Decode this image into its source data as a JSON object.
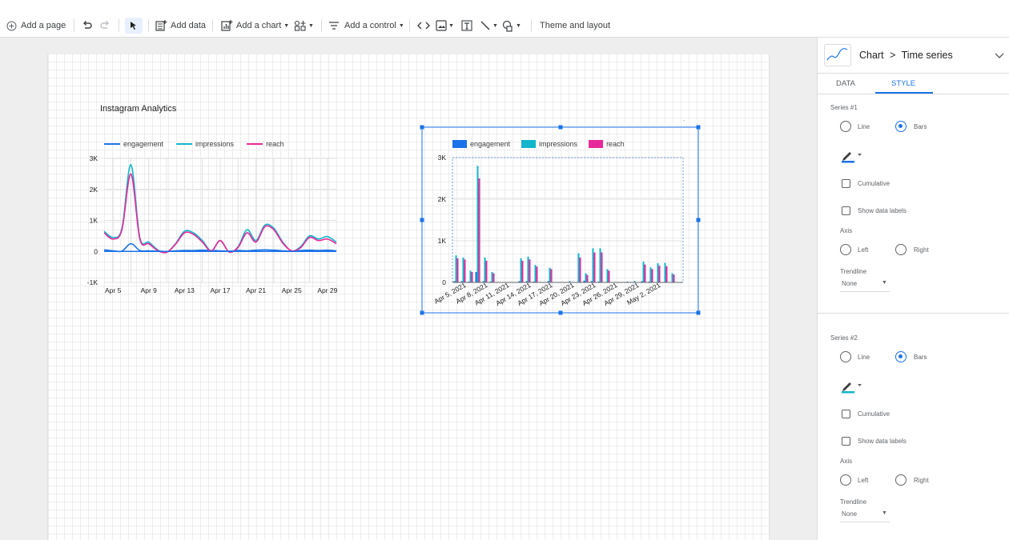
{
  "toolbar": {
    "add_page": "Add a page",
    "add_data": "Add data",
    "add_chart": "Add a chart",
    "add_control": "Add a control",
    "theme_layout": "Theme and layout"
  },
  "panel": {
    "chart_type": "Chart",
    "chart_sub": "Time series",
    "tabs": [
      "DATA",
      "STYLE"
    ],
    "active_tab": "STYLE",
    "series_sections": [
      {
        "title": "Series #1",
        "line": "Line",
        "bars": "Bars",
        "selected": "Bars",
        "cumulative": "Cumulative",
        "data_labels": "Show data labels",
        "axis": "Axis",
        "left": "Left",
        "right": "Right",
        "selected_axis": "none",
        "trendline": "Trendline",
        "trendline_value": "None",
        "color": "#1a73e8"
      },
      {
        "title": "Series #2",
        "line": "Line",
        "bars": "Bars",
        "selected": "Bars",
        "cumulative": "Cumulative",
        "data_labels": "Show data labels",
        "axis": "Axis",
        "left": "Left",
        "right": "Right",
        "selected_axis": "none",
        "trendline": "Trendline",
        "trendline_value": "None",
        "color": "#12b5cb"
      }
    ]
  },
  "colors": {
    "engagement": "#1a73e8",
    "impressions": "#12b5cb",
    "reach": "#e8289a",
    "accent": "#1a73e8"
  },
  "chart_data": [
    {
      "type": "line",
      "title": "Instagram Analytics",
      "legend_position": "top",
      "x_ticks": [
        "Apr 5",
        "Apr 9",
        "Apr 13",
        "Apr 17",
        "Apr 21",
        "Apr 25",
        "Apr 29"
      ],
      "y_ticks": [
        "3K",
        "2K",
        "1K",
        "0",
        "-1K"
      ],
      "ylim": [
        -1000,
        3000
      ],
      "grid": true,
      "x": [
        "Apr 4",
        "Apr 5",
        "Apr 6",
        "Apr 7",
        "Apr 8",
        "Apr 9",
        "Apr 10",
        "Apr 11",
        "Apr 12",
        "Apr 13",
        "Apr 14",
        "Apr 15",
        "Apr 16",
        "Apr 17",
        "Apr 18",
        "Apr 19",
        "Apr 20",
        "Apr 21",
        "Apr 22",
        "Apr 23",
        "Apr 24",
        "Apr 25",
        "Apr 26",
        "Apr 27",
        "Apr 28",
        "Apr 29",
        "Apr 30"
      ],
      "series": [
        {
          "name": "engagement",
          "values": [
            50,
            20,
            10,
            250,
            30,
            20,
            10,
            0,
            20,
            30,
            30,
            40,
            30,
            20,
            10,
            30,
            20,
            40,
            50,
            40,
            20,
            10,
            30,
            40,
            30,
            40,
            20
          ]
        },
        {
          "name": "impressions",
          "values": [
            650,
            450,
            750,
            2800,
            450,
            300,
            50,
            -30,
            250,
            650,
            600,
            350,
            20,
            350,
            -20,
            150,
            700,
            350,
            850,
            750,
            300,
            20,
            150,
            500,
            400,
            480,
            300
          ]
        },
        {
          "name": "reach",
          "values": [
            600,
            400,
            700,
            2500,
            400,
            250,
            30,
            -30,
            230,
            600,
            550,
            300,
            10,
            350,
            -20,
            130,
            600,
            300,
            800,
            700,
            270,
            20,
            120,
            450,
            350,
            400,
            250
          ]
        }
      ]
    },
    {
      "type": "bar",
      "legend_position": "top",
      "x_ticks": [
        "Apr 5, 2021",
        "Apr 8, 2021",
        "Apr 11, 2021",
        "Apr 14, 2021",
        "Apr 17, 2021",
        "Apr 20, 2021",
        "Apr 23, 2021",
        "Apr 26, 2021",
        "Apr 29, 2021",
        "May 2, 2021"
      ],
      "y_ticks": [
        "3K",
        "2K",
        "1K",
        "0"
      ],
      "ylim": [
        0,
        3000
      ],
      "grid": true,
      "x": [
        "Apr 4",
        "Apr 5",
        "Apr 6",
        "Apr 7",
        "Apr 8",
        "Apr 9",
        "Apr 10",
        "Apr 11",
        "Apr 12",
        "Apr 13",
        "Apr 14",
        "Apr 15",
        "Apr 16",
        "Apr 17",
        "Apr 18",
        "Apr 19",
        "Apr 20",
        "Apr 21",
        "Apr 22",
        "Apr 23",
        "Apr 24",
        "Apr 25",
        "Apr 26",
        "Apr 27",
        "Apr 28",
        "Apr 29",
        "Apr 30",
        "May 1",
        "May 2",
        "May 3",
        "May 4",
        "May 5"
      ],
      "series": [
        {
          "name": "engagement",
          "values": [
            30,
            30,
            20,
            250,
            30,
            20,
            10,
            0,
            10,
            30,
            30,
            20,
            10,
            30,
            10,
            10,
            30,
            10,
            40,
            30,
            20,
            10,
            0,
            10,
            20,
            30,
            30,
            20,
            10,
            0,
            0,
            0
          ]
        },
        {
          "name": "impressions",
          "values": [
            650,
            600,
            280,
            2800,
            600,
            250,
            0,
            0,
            0,
            580,
            620,
            420,
            0,
            350,
            0,
            0,
            0,
            700,
            220,
            820,
            820,
            320,
            0,
            0,
            0,
            0,
            500,
            360,
            460,
            470,
            220,
            0
          ]
        },
        {
          "name": "reach",
          "values": [
            580,
            550,
            250,
            2500,
            520,
            220,
            0,
            0,
            0,
            520,
            550,
            380,
            0,
            320,
            0,
            0,
            0,
            600,
            180,
            720,
            720,
            280,
            0,
            0,
            0,
            0,
            430,
            320,
            400,
            390,
            190,
            0
          ]
        }
      ]
    }
  ]
}
